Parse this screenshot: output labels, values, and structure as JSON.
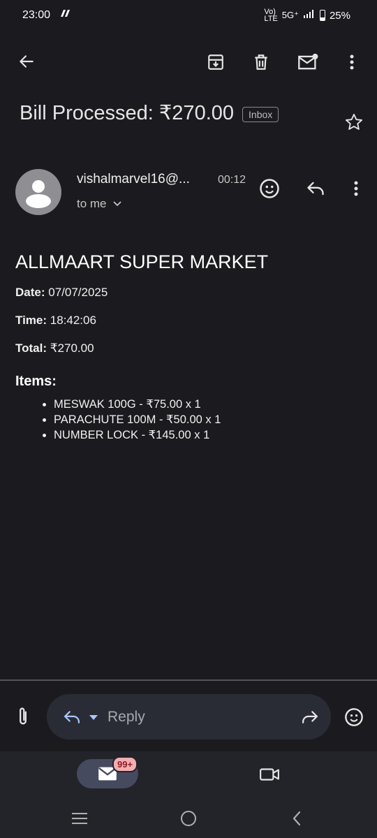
{
  "status": {
    "time": "23:00",
    "network": "5G⁺",
    "battery": "25%"
  },
  "toolbar": {
    "back_icon": "arrow-left-icon",
    "archive_icon": "archive-icon",
    "delete_icon": "trash-icon",
    "unread_icon": "mark-unread-icon",
    "more_icon": "more-vert-icon"
  },
  "email": {
    "subject": "Bill Processed: ₹270.00",
    "label": "Inbox",
    "sender": "vishalmarvel16@...",
    "time": "00:12",
    "recipient": "to me"
  },
  "body": {
    "store": "ALLMAART SUPER MARKET",
    "date_label": "Date:",
    "date_value": " 07/07/2025",
    "time_label": "Time:",
    "time_value": " 18:42:06",
    "total_label": "Total:",
    "total_value": " ₹270.00",
    "items_heading": "Items:",
    "items": [
      "MESWAK 100G - ₹75.00 x 1",
      "PARACHUTE 100M - ₹50.00 x 1",
      "NUMBER LOCK - ₹145.00 x 1"
    ]
  },
  "compose": {
    "reply_placeholder": "Reply"
  },
  "nav": {
    "mail_badge": "99+"
  },
  "colors": {
    "background": "#1b1b1f",
    "reply_blue": "#a9c7ff",
    "badge": "#f3aeb1"
  }
}
